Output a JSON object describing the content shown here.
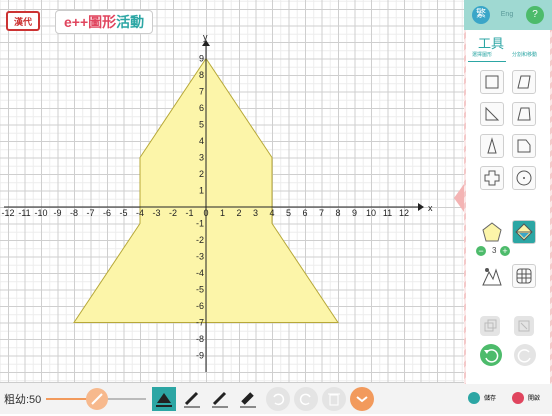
{
  "header": {
    "logo_text": "漢代",
    "title_part1": "e++圖形",
    "title_part2": "活動"
  },
  "axes": {
    "x_label": "x",
    "y_label": "y",
    "x_ticks": [
      "-12",
      "-11",
      "-10",
      "-9",
      "-8",
      "-7",
      "-6",
      "-5",
      "-4",
      "-3",
      "-2",
      "-1",
      "0",
      "1",
      "2",
      "3",
      "4",
      "5",
      "6",
      "7",
      "8",
      "9",
      "10",
      "11",
      "12"
    ],
    "y_ticks": [
      "9",
      "8",
      "7",
      "6",
      "5",
      "4",
      "3",
      "2",
      "1",
      "-1",
      "-2",
      "-3",
      "-4",
      "-5",
      "-6",
      "-7",
      "-8",
      "-9"
    ]
  },
  "shape": {
    "vertices": [
      [
        0,
        9
      ],
      [
        -4,
        3
      ],
      [
        -4,
        -1
      ],
      [
        -8,
        -7
      ],
      [
        8,
        -7
      ],
      [
        4,
        -1
      ],
      [
        4,
        3
      ]
    ],
    "fill_color": "#fcf5a9",
    "stroke_color": "#b7a838"
  },
  "side_panel": {
    "top_buttons": [
      "繁",
      "Eng",
      "?"
    ],
    "tools_title": "工具",
    "subtab_left": "選擇圖形",
    "subtab_right": "分割和移動",
    "polygon_count": "3",
    "save_label": "儲存",
    "open_label": "開啟"
  },
  "bottom_bar": {
    "thickness_label": "粗幼:50",
    "thickness_value": 50
  },
  "colors": {
    "accent": "#2ca6a4",
    "brand_red": "#e0455e",
    "orange": "#f29a5c"
  }
}
